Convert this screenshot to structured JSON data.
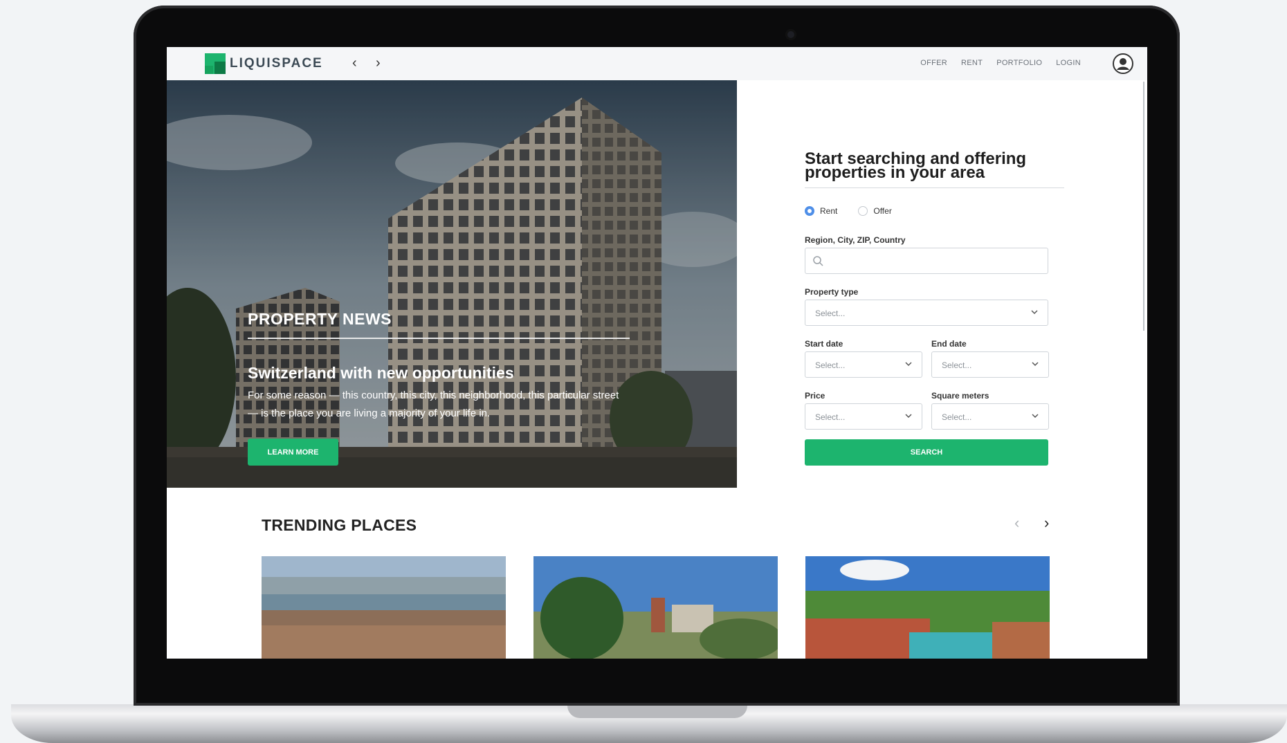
{
  "header": {
    "logo_text": "LIQUISPACE",
    "back_glyph": "‹",
    "forward_glyph": "›",
    "menu": [
      "OFFER",
      "RENT",
      "PORTFOLIO",
      "LOGIN"
    ]
  },
  "hero": {
    "section_label": "PROPERTY NEWS",
    "title": "Switzerland with new opportunities",
    "text": "For some reason — this country, this city, this neighborhood, this particular street — is the place you are living a majority of your life in.",
    "button_label": "LEARN MORE"
  },
  "search": {
    "title": "Start searching and offering properties in your area",
    "radio_rent": "Rent",
    "radio_offer": "Offer",
    "location_label": "Region, City, ZIP, Country",
    "property_type_label": "Property type",
    "start_date_label": "Start date",
    "end_date_label": "End date",
    "price_label": "Price",
    "sqm_label": "Square meters",
    "select_placeholder": "Select...",
    "button_label": "SEARCH"
  },
  "trending": {
    "title": "TRENDING PLACES",
    "prev_glyph": "‹",
    "next_glyph": "›"
  },
  "colors": {
    "accent": "#1db46e",
    "radio_selected": "#4f8fe8"
  }
}
